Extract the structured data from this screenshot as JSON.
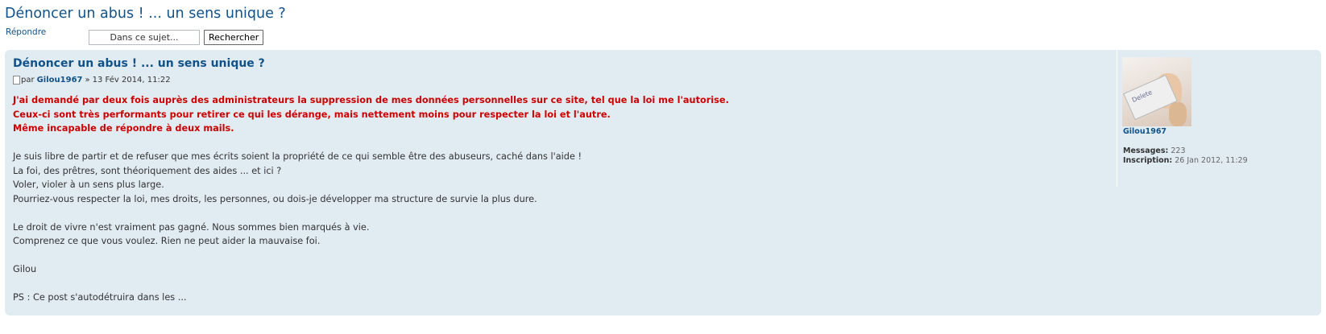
{
  "page": {
    "title": "Dénoncer un abus ! ... un sens unique ?",
    "reply_label": "Répondre"
  },
  "search": {
    "placeholder": "Dans ce sujet...",
    "button_label": "Rechercher"
  },
  "post": {
    "subject": "Dénoncer un abus ! ... un sens unique ?",
    "by_label": "par",
    "author": "Gilou1967",
    "date_sep": "»",
    "date": "13 Fév 2014, 11:22",
    "content": {
      "red_lines": [
        "J'ai demandé par deux fois auprès des administrateurs la suppression de mes données personnelles sur ce site, tel que la loi me l'autorise.",
        "Ceux-ci sont très performants pour retirer ce qui les dérange, mais nettement moins pour respecter la loi et l'autre.",
        "Même incapable de répondre à deux mails."
      ],
      "paragraph1": [
        "Je suis libre de partir et de refuser que mes écrits soient la propriété de ce qui semble être des abuseurs, caché dans l'aide !",
        "La foi, des prêtres, sont théoriquement des aides ... et ici ?",
        "Voler, violer à un sens plus large.",
        "Pourriez-vous respecter la loi, mes droits, les personnes, ou dois-je développer ma structure de survie la plus dure."
      ],
      "paragraph2": [
        "Le droit de vivre n'est vraiment pas gagné. Nous sommes bien marqués à vie.",
        "Comprenez ce que vous voulez. Rien ne peut aider la mauvaise foi."
      ],
      "signature": "Gilou",
      "ps": "PS : Ce post s'autodétruira dans les ..."
    }
  },
  "profile": {
    "name": "Gilou1967",
    "avatar_key_text": "Delete",
    "messages_label": "Messages:",
    "messages_value": "223",
    "inscription_label": "Inscription:",
    "inscription_value": "26 Jan 2012, 11:29"
  },
  "colors": {
    "link": "#105289",
    "post_bg": "#e1ebf2",
    "alert_red": "#cc0000"
  }
}
